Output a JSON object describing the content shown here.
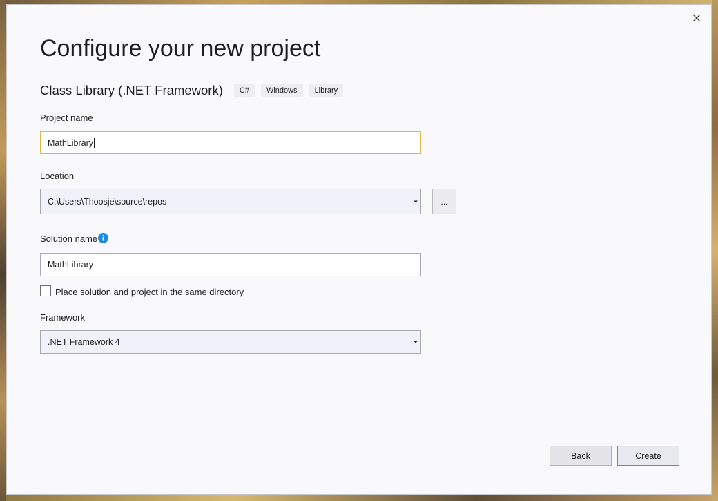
{
  "dialog": {
    "title": "Configure your new project",
    "close_icon": "close-icon"
  },
  "template": {
    "name": "Class Library (.NET Framework)",
    "tags": [
      "C#",
      "Windows",
      "Library"
    ]
  },
  "project_name": {
    "label": "Project name",
    "value": "MathLibrary"
  },
  "location": {
    "label": "Location",
    "value": "C:\\Users\\Thoosje\\source\\repos",
    "browse_label": "..."
  },
  "solution_name": {
    "label": "Solution name",
    "value": "MathLibrary",
    "info_icon": "info-icon"
  },
  "same_directory": {
    "label": "Place solution and project in the same directory",
    "checked": false
  },
  "framework": {
    "label": "Framework",
    "value": ".NET Framework 4"
  },
  "buttons": {
    "back": "Back",
    "create": "Create"
  },
  "colors": {
    "accent": "#1c8ce0",
    "focus_border": "#e0b84a",
    "primary_border": "#4a90d9"
  }
}
